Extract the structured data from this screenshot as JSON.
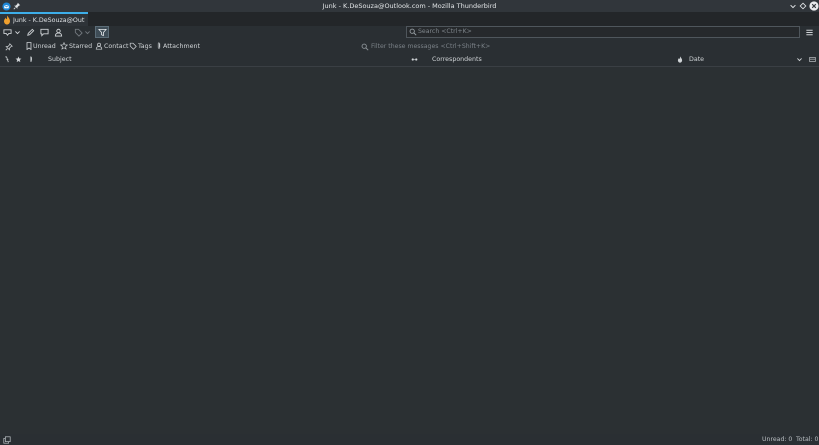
{
  "window": {
    "title": "Junk - K.DeSouza@Outlook.com - Mozilla Thunderbird"
  },
  "tab": {
    "label": "Junk - K.DeSouza@Outlook.com"
  },
  "toolbar": {
    "search_placeholder": "Search <Ctrl+K>"
  },
  "quick_filter": {
    "unread": "Unread",
    "starred": "Starred",
    "contact": "Contact",
    "tags": "Tags",
    "attachment": "Attachment",
    "filter_placeholder": "Filter these messages <Ctrl+Shift+K>"
  },
  "columns": {
    "subject": "Subject",
    "correspondents": "Correspondents",
    "date": "Date"
  },
  "status": {
    "unread": "Unread: 0",
    "total": "Total: 0"
  },
  "colors": {
    "accent": "#3daee9",
    "background": "#2a2f33"
  }
}
